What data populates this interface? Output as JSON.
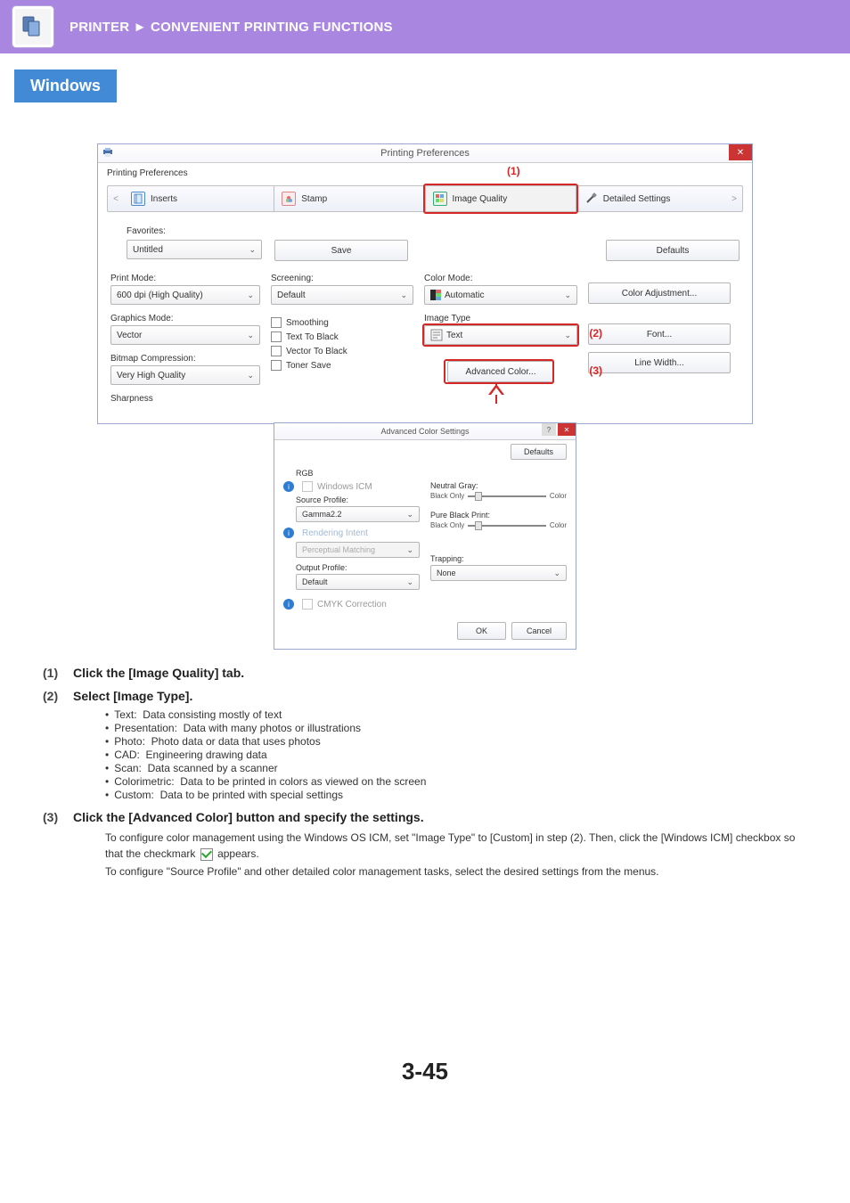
{
  "header": {
    "breadcrumb_cat": "PRINTER",
    "breadcrumb_sep": "►",
    "breadcrumb_page": "CONVENIENT PRINTING FUNCTIONS"
  },
  "os": "Windows",
  "dialog": {
    "title": "Printing Preferences",
    "subtitle": "Printing Preferences",
    "callouts": {
      "n1": "(1)",
      "n2": "(2)",
      "n3": "(3)"
    },
    "tabs": {
      "inserts": "Inserts",
      "stamp": "Stamp",
      "image_quality": "Image Quality",
      "detailed": "Detailed Settings"
    },
    "favorites_label": "Favorites:",
    "favorites_value": "Untitled",
    "save": "Save",
    "defaults": "Defaults",
    "print_mode_label": "Print Mode:",
    "print_mode_value": "600 dpi (High Quality)",
    "screening_label": "Screening:",
    "screening_value": "Default",
    "color_mode_label": "Color Mode:",
    "color_mode_value": "Automatic",
    "color_adjust": "Color Adjustment...",
    "graphics_mode_label": "Graphics Mode:",
    "graphics_mode_value": "Vector",
    "image_type_label": "Image Type",
    "image_type_value": "Text",
    "font_btn": "Font...",
    "bitmap_label": "Bitmap Compression:",
    "bitmap_value": "Very High Quality",
    "line_width_btn": "Line Width...",
    "advanced_color_btn": "Advanced Color...",
    "smoothing": "Smoothing",
    "text_to_black": "Text To Black",
    "vector_to_black": "Vector To Black",
    "toner_save": "Toner Save",
    "sharpness_label": "Sharpness"
  },
  "advanced": {
    "title": "Advanced Color Settings",
    "defaults": "Defaults",
    "rgb": "RGB",
    "windows_icm": "Windows ICM",
    "source_profile_label": "Source Profile:",
    "source_profile_value": "Gamma2.2",
    "rendering_intent_label": "Rendering Intent",
    "rendering_intent_value": "Perceptual Matching",
    "output_profile_label": "Output Profile:",
    "output_profile_value": "Default",
    "cmyk": "CMYK Correction",
    "neutral_gray_label": "Neutral Gray:",
    "black_only_l": "Black Only",
    "color_r": "Color",
    "pure_black_label": "Pure Black Print:",
    "trapping_label": "Trapping:",
    "trapping_value": "None",
    "ok": "OK",
    "cancel": "Cancel"
  },
  "steps": {
    "s1": "Click the [Image Quality] tab.",
    "s2": "Select [Image Type].",
    "bullets": {
      "b1_k": "Text:",
      "b1_v": "Data consisting mostly of text",
      "b2_k": "Presentation:",
      "b2_v": "Data with many photos or illustrations",
      "b3_k": "Photo:",
      "b3_v": "Photo data or data that uses photos",
      "b4_k": "CAD:",
      "b4_v": "Engineering drawing data",
      "b5_k": "Scan:",
      "b5_v": "Data scanned by a scanner",
      "b6_k": "Colorimetric:",
      "b6_v": "Data to be printed in colors as viewed on the screen",
      "b7_k": "Custom:",
      "b7_v": "Data to be printed with special settings"
    },
    "s3": "Click the [Advanced Color] button and specify the settings.",
    "s3_p1a": "To configure color management using the Windows OS ICM, set \"Image Type\" to [Custom] in step (2). Then, click the [Windows ICM] checkbox so that the checkmark ",
    "s3_p1b": " appears.",
    "s3_p2": "To configure \"Source Profile\" and other detailed color management tasks, select the desired settings from the menus."
  },
  "pagenum": "3-45"
}
